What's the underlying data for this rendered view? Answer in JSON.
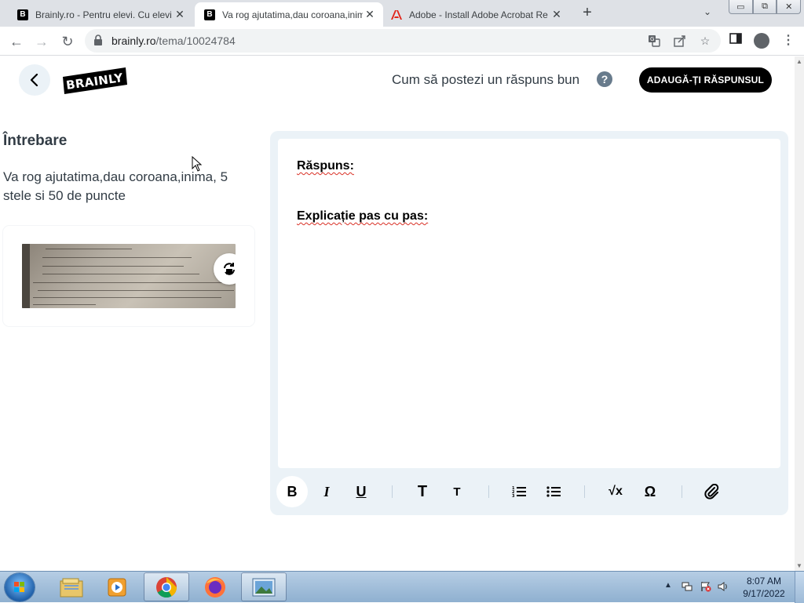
{
  "browser": {
    "tabs": [
      {
        "title": "Brainly.ro - Pentru elevi. Cu elevi.",
        "active": false,
        "favicon": "brainly-b-icon"
      },
      {
        "title": "Va rog ajutatima,dau coroana,inima",
        "active": true,
        "favicon": "brainly-b-icon"
      },
      {
        "title": "Adobe - Install Adobe Acrobat Re",
        "active": false,
        "favicon": "adobe-icon"
      }
    ],
    "new_tab_label": "+",
    "tab_menu_label": "⌄",
    "window_controls": {
      "minimize": "▭",
      "maximize": "⧉",
      "close": "✕"
    },
    "nav": {
      "back": "←",
      "forward": "→",
      "reload": "↻"
    },
    "url_host": "brainly.ro",
    "url_path": "/tema/10024784",
    "omnibox_icons": [
      "translate-icon",
      "share-icon",
      "star-icon"
    ],
    "sidepanel_icon": "sidepanel-icon",
    "profile_icon": "profile-icon",
    "menu_label": "⋮"
  },
  "header": {
    "back_icon": "chevron-left-icon",
    "logo_text": "BRAINLY",
    "howto_link": "Cum să postezi un răspuns bun",
    "help_icon_label": "?",
    "add_answer_label": "ADAUGĂ-ȚI RĂSPUNSUL"
  },
  "question": {
    "heading": "Întrebare",
    "text": "Va rog ajutatima,dau coroana,inima, 5 stele si 50 de puncte",
    "attachment": {
      "kind": "photo of textbook exercises",
      "rotate_icon": "rotate-image-icon"
    }
  },
  "editor": {
    "line1": "Răspuns:",
    "line2": "Explicație pas cu pas:",
    "toolbar": [
      {
        "name": "bold-button",
        "label": "B",
        "active": true
      },
      {
        "name": "italic-button",
        "label": "I",
        "active": false
      },
      {
        "name": "underline-button",
        "label": "U",
        "active": false
      },
      {
        "name": "heading-large-button",
        "label": "T",
        "active": false
      },
      {
        "name": "heading-small-button",
        "label": "T",
        "active": false
      },
      {
        "name": "numbered-list-button",
        "label": "numbered-list-icon",
        "active": false
      },
      {
        "name": "bullet-list-button",
        "label": "bullet-list-icon",
        "active": false
      },
      {
        "name": "math-formula-button",
        "label": "√x",
        "active": false
      },
      {
        "name": "special-characters-button",
        "label": "Ω",
        "active": false
      },
      {
        "name": "attach-button",
        "label": "paperclip-icon",
        "active": false
      }
    ]
  },
  "taskbar": {
    "apps": [
      "windows-explorer-icon",
      "media-player-icon",
      "chrome-icon",
      "firefox-icon",
      "image-viewer-icon"
    ],
    "tray_arrow": "▲",
    "time": "8:07 AM",
    "date": "9/17/2022"
  },
  "colors": {
    "accent_black": "#000000",
    "editor_bg": "#ebf2f7",
    "text_gray": "#323c45",
    "taskbar": "#9ab8d6"
  }
}
